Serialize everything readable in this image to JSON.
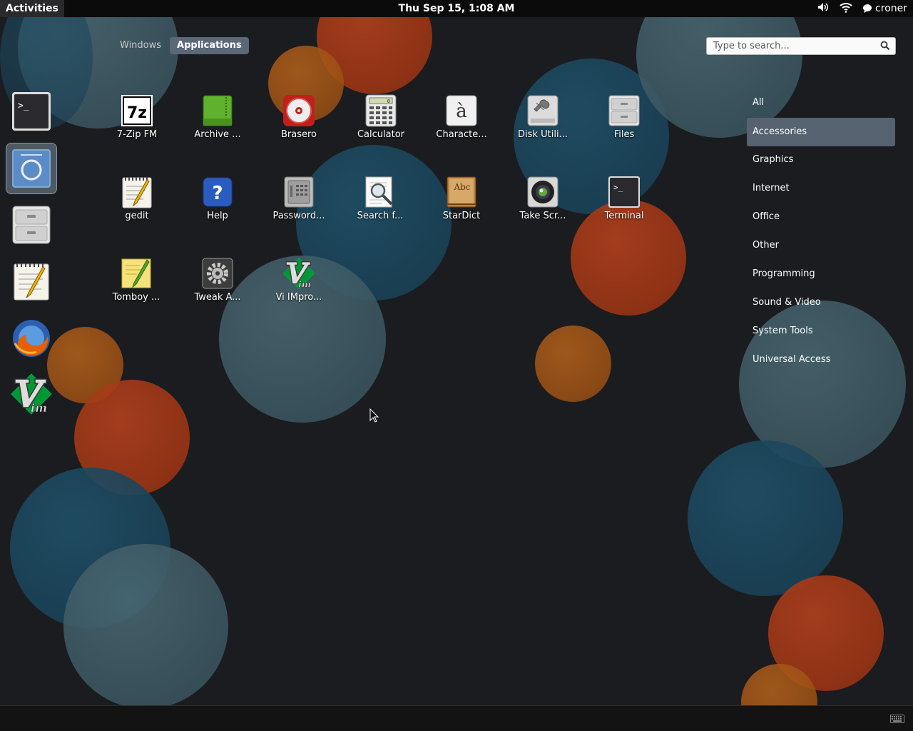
{
  "panel": {
    "activities": "Activities",
    "clock": "Thu Sep 15,  1:08 AM",
    "user": "croner"
  },
  "view_tabs": [
    "Windows",
    "Applications"
  ],
  "active_view": "Applications",
  "search": {
    "placeholder": "Type to search..."
  },
  "dash_items": [
    {
      "name": "terminal",
      "icon": "terminal-icon"
    },
    {
      "name": "web browser",
      "icon": "browser-icon",
      "running": true
    },
    {
      "name": "files",
      "icon": "filing-cabinet-icon"
    },
    {
      "name": "gedit",
      "icon": "notepad-pencil-icon"
    },
    {
      "name": "firefox",
      "icon": "firefox-icon"
    },
    {
      "name": "vim",
      "icon": "vim-icon"
    }
  ],
  "apps": [
    {
      "label": "7-Zip FM",
      "icon": "7zip-icon"
    },
    {
      "label": "Archive ...",
      "icon": "archive-icon"
    },
    {
      "label": "Brasero",
      "icon": "disc-icon"
    },
    {
      "label": "Calculator",
      "icon": "calculator-icon"
    },
    {
      "label": "Characte...",
      "icon": "character-map-icon"
    },
    {
      "label": "Disk Utili...",
      "icon": "disk-utility-icon"
    },
    {
      "label": "Files",
      "icon": "filing-cabinet-icon"
    },
    {
      "label": "gedit",
      "icon": "notepad-pencil-icon"
    },
    {
      "label": "Help",
      "icon": "help-icon"
    },
    {
      "label": "Password...",
      "icon": "safe-icon"
    },
    {
      "label": "Search f...",
      "icon": "search-magnifier-icon"
    },
    {
      "label": "StarDict",
      "icon": "dictionary-icon"
    },
    {
      "label": "Take Scr...",
      "icon": "camera-icon"
    },
    {
      "label": "Terminal",
      "icon": "terminal-icon"
    },
    {
      "label": "Tomboy ...",
      "icon": "sticky-note-icon"
    },
    {
      "label": "Tweak A...",
      "icon": "tweak-gear-icon"
    },
    {
      "label": "Vi IMpro...",
      "icon": "vim-icon"
    }
  ],
  "categories": [
    "All",
    "Accessories",
    "Graphics",
    "Internet",
    "Office",
    "Other",
    "Programming",
    "Sound & Video",
    "System Tools",
    "Universal Access"
  ],
  "active_category": "Accessories",
  "colors": {
    "background": "#1b1c1f",
    "selected": "#566270",
    "panel": "#0b0b0b"
  }
}
